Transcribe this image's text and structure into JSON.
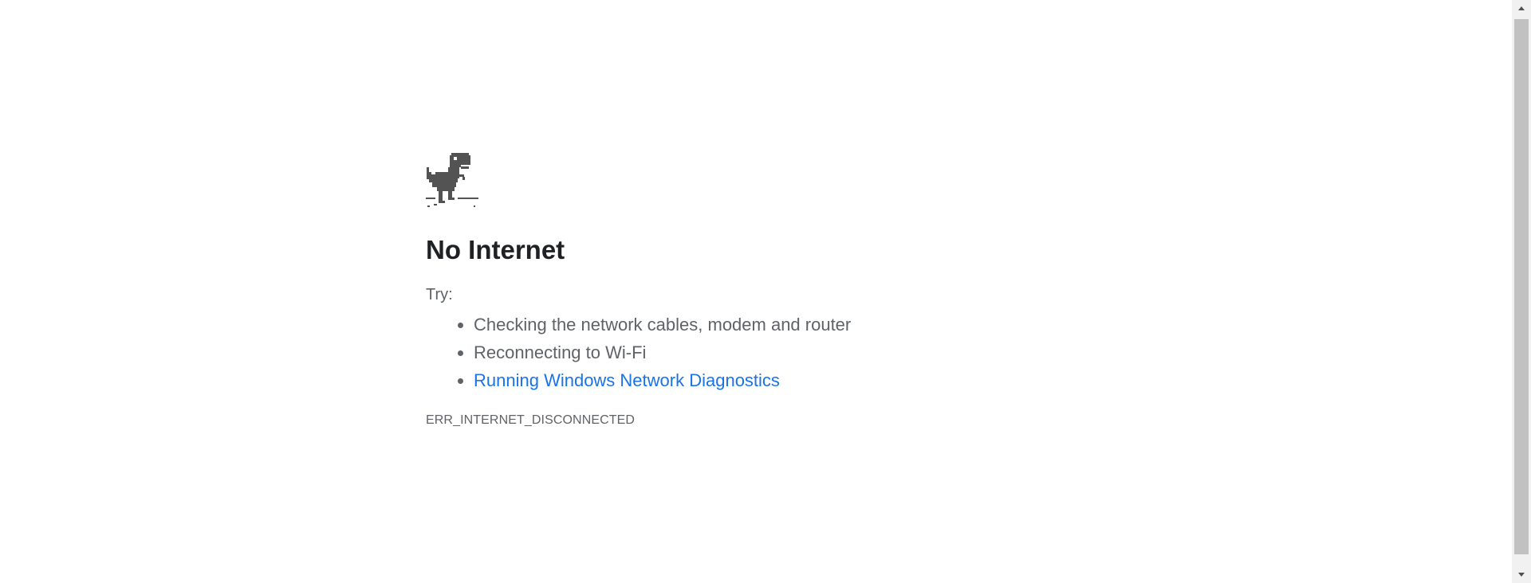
{
  "main": {
    "title": "No Internet",
    "try_label": "Try:",
    "suggestions": [
      "Checking the network cables, modem and router",
      "Reconnecting to Wi-Fi"
    ],
    "diagnostics_link": "Running Windows Network Diagnostics",
    "error_code": "ERR_INTERNET_DISCONNECTED"
  },
  "icons": {
    "dino": "offline-dino-icon",
    "scroll_up": "chevron-up-icon",
    "scroll_down": "chevron-down-icon"
  },
  "colors": {
    "title": "#202124",
    "text": "#5f6368",
    "link": "#1a73e8",
    "dino": "#535353"
  }
}
